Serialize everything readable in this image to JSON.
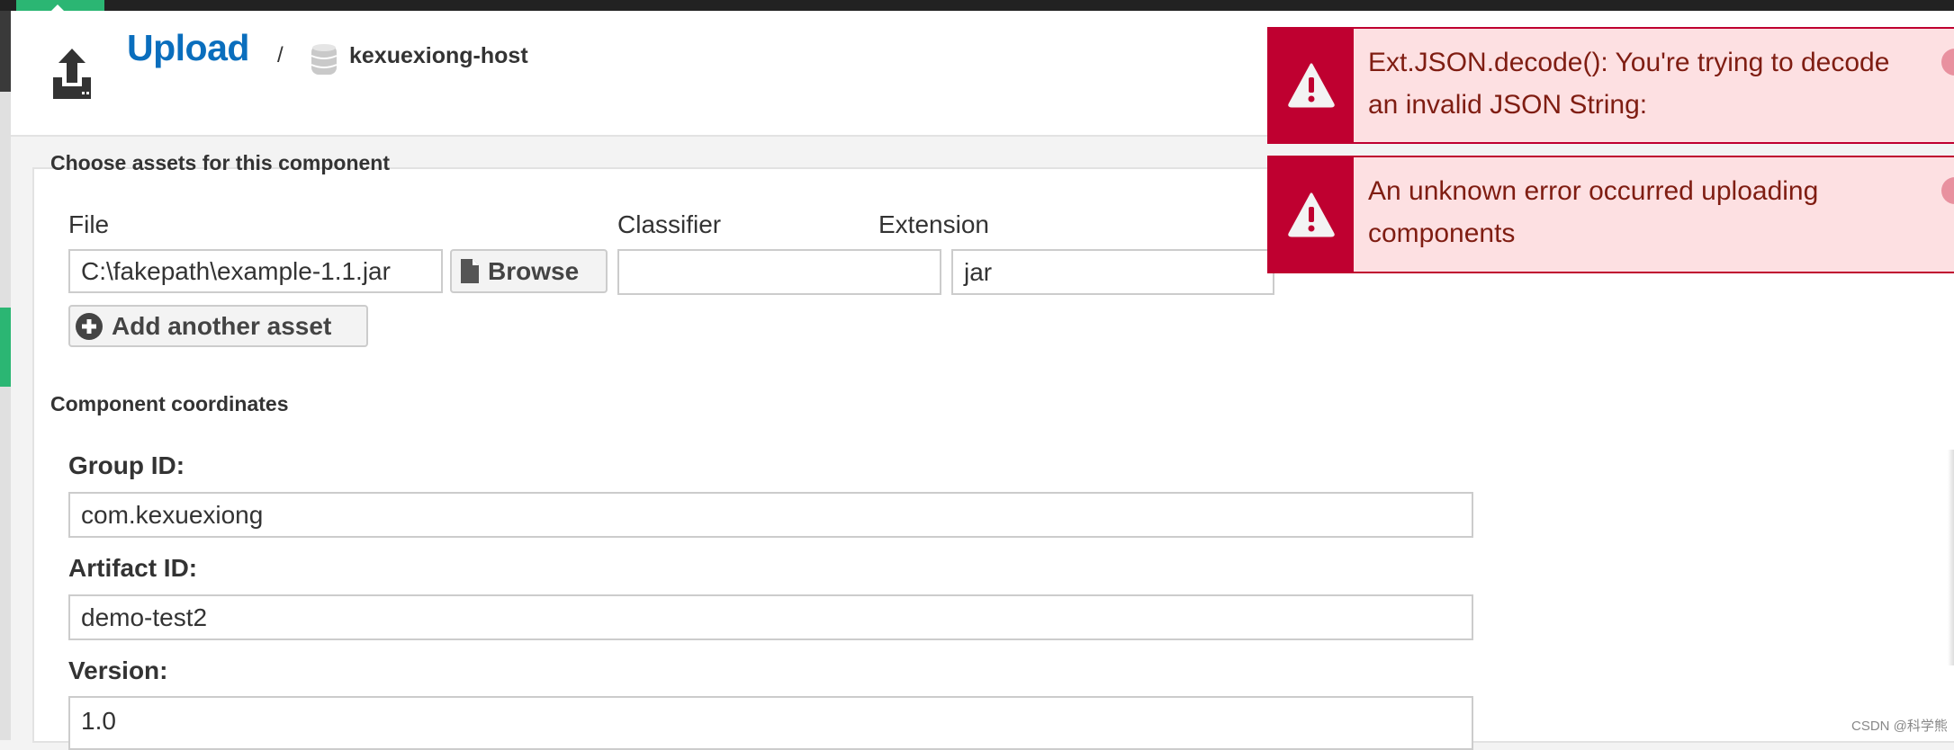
{
  "header": {
    "title": "Upload",
    "separator": "/",
    "repository": "kexuexiong-host",
    "icons": [
      "upload-icon",
      "database-icon"
    ]
  },
  "assets": {
    "section_title": "Choose assets for this component",
    "file_label": "File",
    "file_value": "C:\\fakepath\\example-1.1.jar",
    "browse_label": "Browse",
    "classifier_label": "Classifier",
    "classifier_value": "",
    "extension_label": "Extension",
    "extension_value": "jar",
    "add_asset_label": "Add another asset"
  },
  "coordinates": {
    "section_title": "Component coordinates",
    "group_label": "Group ID:",
    "group_value": "com.kexuexiong",
    "artifact_label": "Artifact ID:",
    "artifact_value": "demo-test2",
    "version_label": "Version:",
    "version_value": "1.0"
  },
  "alerts": [
    {
      "message": "Ext.JSON.decode(): You're trying to decode an invalid JSON String:"
    },
    {
      "message": "An unknown error occurred uploading components"
    }
  ],
  "colors": {
    "accent": "#0a6ebd",
    "error": "#bf0030",
    "error_bg": "#fde0e2",
    "nav_green": "#2bb673"
  },
  "watermark": "CSDN @科学熊"
}
